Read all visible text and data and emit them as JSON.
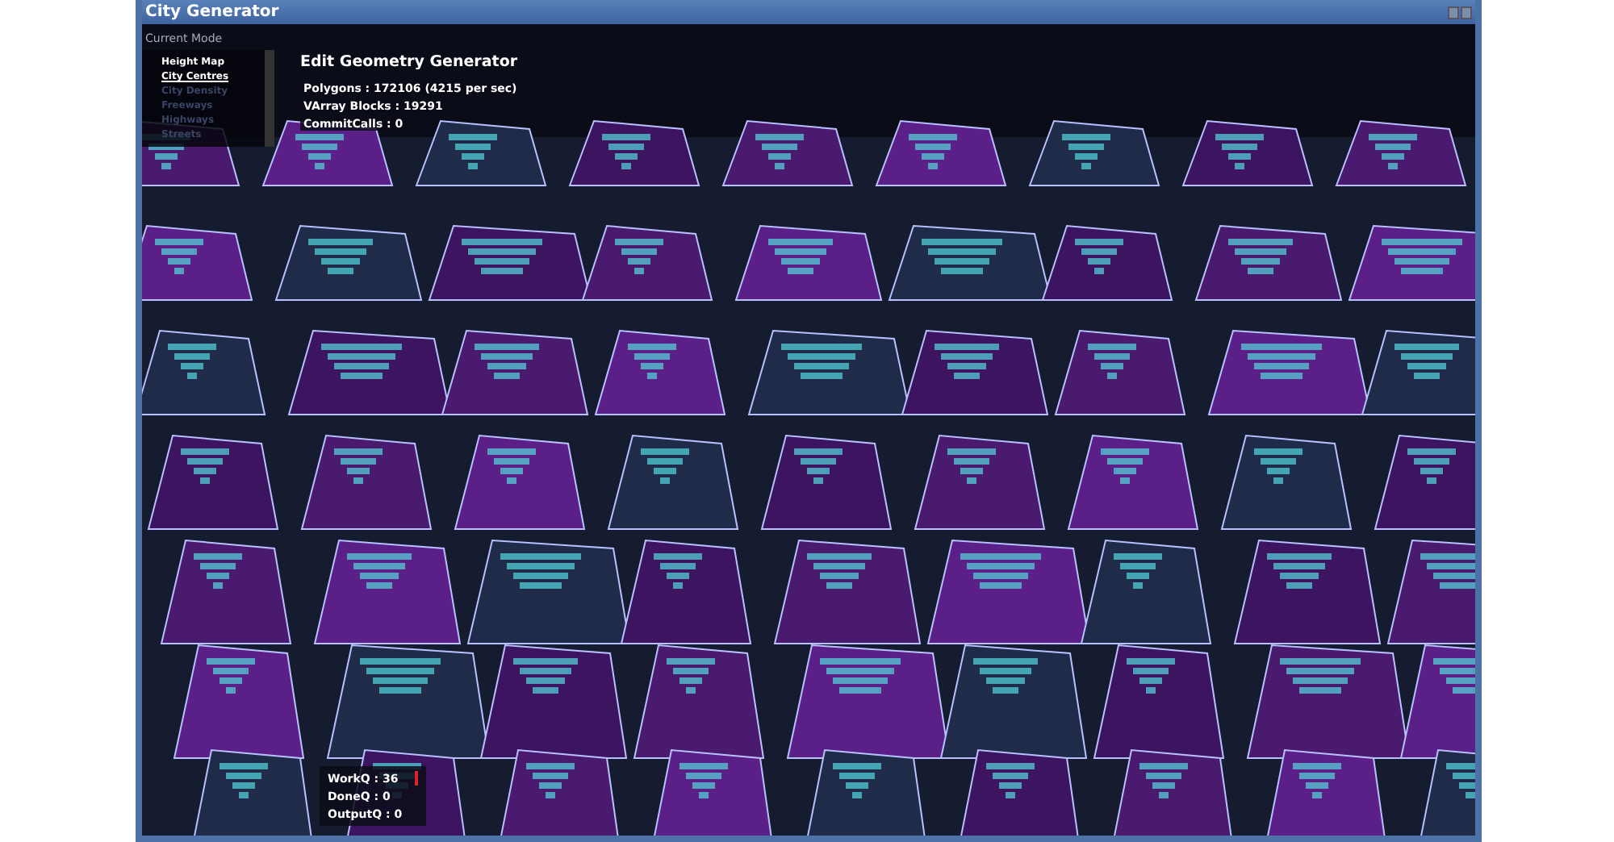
{
  "window": {
    "title": "City Generator"
  },
  "mode_panel": {
    "heading": "Current Mode",
    "items": [
      {
        "label": "Height Map",
        "selected": false,
        "disabled": false
      },
      {
        "label": "City Centres",
        "selected": true,
        "disabled": false
      },
      {
        "label": "City Density",
        "selected": false,
        "disabled": true
      },
      {
        "label": "Freeways",
        "selected": false,
        "disabled": true
      },
      {
        "label": "Highways",
        "selected": false,
        "disabled": true
      },
      {
        "label": "Streets",
        "selected": false,
        "disabled": true
      }
    ]
  },
  "stats": {
    "title": "Edit Geometry Generator",
    "lines": [
      "Polygons : 172106 (4215 per sec)",
      "VArray Blocks : 19291",
      "CommitCalls : 0"
    ]
  },
  "queues": [
    {
      "label": "WorkQ : 36",
      "busy": true
    },
    {
      "label": "DoneQ : 0",
      "busy": false
    },
    {
      "label": "OutputQ : 0",
      "busy": false
    }
  ]
}
